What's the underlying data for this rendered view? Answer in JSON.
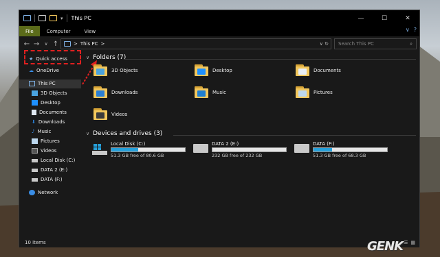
{
  "window": {
    "title": "This PC"
  },
  "titlebar_controls": {
    "minimize": "—",
    "maximize": "☐",
    "close": "✕"
  },
  "ribbon": {
    "tabs": [
      "File",
      "Computer",
      "View"
    ],
    "expand": "∨",
    "help": "?"
  },
  "address": {
    "path": "This PC",
    "separator": ">",
    "dropdown": "∨",
    "refresh": "↻"
  },
  "search": {
    "placeholder": "Search This PC",
    "icon": "🔍"
  },
  "sidebar": {
    "items": [
      {
        "label": "Quick access",
        "icon": "star-icon"
      },
      {
        "label": "OneDrive",
        "icon": "cloud-icon"
      },
      {
        "label": "This PC",
        "icon": "monitor-icon"
      },
      {
        "label": "3D Objects",
        "icon": "cube-icon"
      },
      {
        "label": "Desktop",
        "icon": "desktop-icon"
      },
      {
        "label": "Documents",
        "icon": "document-icon"
      },
      {
        "label": "Downloads",
        "icon": "download-icon"
      },
      {
        "label": "Music",
        "icon": "music-icon"
      },
      {
        "label": "Pictures",
        "icon": "picture-icon"
      },
      {
        "label": "Videos",
        "icon": "video-icon"
      },
      {
        "label": "Local Disk (C:)",
        "icon": "drive-icon"
      },
      {
        "label": "DATA 2 (E:)",
        "icon": "drive-icon"
      },
      {
        "label": "DATA (F:)",
        "icon": "drive-icon"
      },
      {
        "label": "Network",
        "icon": "network-icon"
      }
    ]
  },
  "folders": {
    "heading": "Folders (7)",
    "items": [
      {
        "label": "3D Objects",
        "overlay": "#4aa3df"
      },
      {
        "label": "Desktop",
        "overlay": "#1e90ff"
      },
      {
        "label": "Documents",
        "overlay": "#e8eef5"
      },
      {
        "label": "Downloads",
        "overlay": "#2a7fd4"
      },
      {
        "label": "Music",
        "overlay": "#1f7fd0"
      },
      {
        "label": "Pictures",
        "overlay": "#bcd7ee"
      },
      {
        "label": "Videos",
        "overlay": "#3b3b3b"
      }
    ]
  },
  "drives": {
    "heading": "Devices and drives (3)",
    "items": [
      {
        "label": "Local Disk (C:)",
        "free": "51.3 GB free of 80.6 GB",
        "used_fraction": 0.36
      },
      {
        "label": "DATA 2 (E:)",
        "free": "232 GB free of 232 GB",
        "used_fraction": 0.0
      },
      {
        "label": "DATA (F:)",
        "free": "51.3 GB free of 68.3 GB",
        "used_fraction": 0.25
      }
    ]
  },
  "status": {
    "count": "10 items"
  },
  "watermark": {
    "brand": "GENK"
  },
  "colors": {
    "accent": "#26a0da",
    "file_tab": "#5b6b1a",
    "highlight": "#e02020"
  }
}
